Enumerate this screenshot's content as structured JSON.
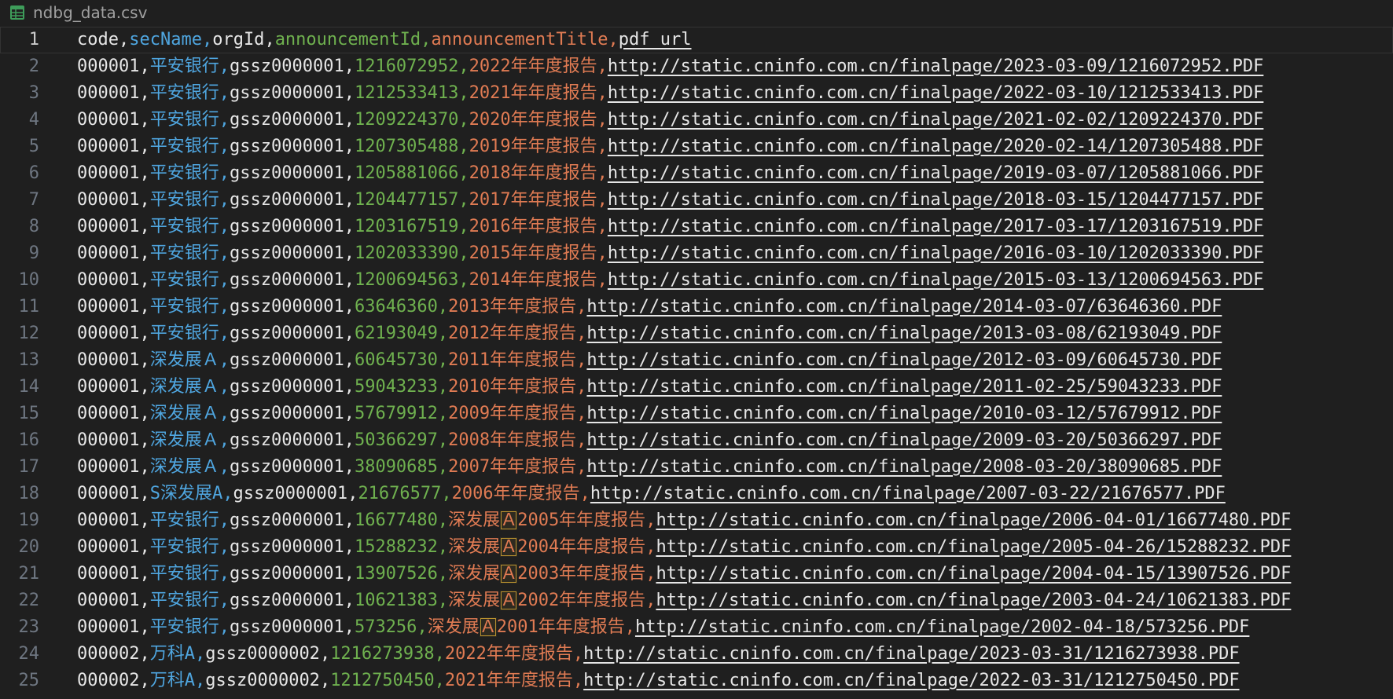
{
  "tab": {
    "title": "ndbg_data.csv",
    "icon": "table-icon",
    "icon_color": "#3e9d5a"
  },
  "editor": {
    "current_line": 1,
    "colors": {
      "code": "#e6e6e6",
      "secName": "#4fa6e0",
      "orgId": "#e6e6e6",
      "announcementId": "#6fb14f",
      "announcementTitle": "#e07b53",
      "pdf_url": "#e6e6e6",
      "line_number": "#6e7681",
      "background": "#1f1f1f"
    },
    "lines": [
      {
        "n": "1",
        "fields": [
          "code",
          "secName",
          "orgId",
          "announcementId",
          "announcementTitle",
          "pdf_url"
        ]
      },
      {
        "n": "2",
        "fields": [
          "000001",
          "平安银行",
          "gssz0000001",
          "1216072952",
          "2022年年度报告",
          "http://static.cninfo.com.cn/finalpage/2023-03-09/1216072952.PDF"
        ]
      },
      {
        "n": "3",
        "fields": [
          "000001",
          "平安银行",
          "gssz0000001",
          "1212533413",
          "2021年年度报告",
          "http://static.cninfo.com.cn/finalpage/2022-03-10/1212533413.PDF"
        ]
      },
      {
        "n": "4",
        "fields": [
          "000001",
          "平安银行",
          "gssz0000001",
          "1209224370",
          "2020年年度报告",
          "http://static.cninfo.com.cn/finalpage/2021-02-02/1209224370.PDF"
        ]
      },
      {
        "n": "5",
        "fields": [
          "000001",
          "平安银行",
          "gssz0000001",
          "1207305488",
          "2019年年度报告",
          "http://static.cninfo.com.cn/finalpage/2020-02-14/1207305488.PDF"
        ]
      },
      {
        "n": "6",
        "fields": [
          "000001",
          "平安银行",
          "gssz0000001",
          "1205881066",
          "2018年年度报告",
          "http://static.cninfo.com.cn/finalpage/2019-03-07/1205881066.PDF"
        ]
      },
      {
        "n": "7",
        "fields": [
          "000001",
          "平安银行",
          "gssz0000001",
          "1204477157",
          "2017年年度报告",
          "http://static.cninfo.com.cn/finalpage/2018-03-15/1204477157.PDF"
        ]
      },
      {
        "n": "8",
        "fields": [
          "000001",
          "平安银行",
          "gssz0000001",
          "1203167519",
          "2016年年度报告",
          "http://static.cninfo.com.cn/finalpage/2017-03-17/1203167519.PDF"
        ]
      },
      {
        "n": "9",
        "fields": [
          "000001",
          "平安银行",
          "gssz0000001",
          "1202033390",
          "2015年年度报告",
          "http://static.cninfo.com.cn/finalpage/2016-03-10/1202033390.PDF"
        ]
      },
      {
        "n": "10",
        "fields": [
          "000001",
          "平安银行",
          "gssz0000001",
          "1200694563",
          "2014年年度报告",
          "http://static.cninfo.com.cn/finalpage/2015-03-13/1200694563.PDF"
        ]
      },
      {
        "n": "11",
        "fields": [
          "000001",
          "平安银行",
          "gssz0000001",
          "63646360",
          "2013年年度报告",
          "http://static.cninfo.com.cn/finalpage/2014-03-07/63646360.PDF"
        ]
      },
      {
        "n": "12",
        "fields": [
          "000001",
          "平安银行",
          "gssz0000001",
          "62193049",
          "2012年年度报告",
          "http://static.cninfo.com.cn/finalpage/2013-03-08/62193049.PDF"
        ]
      },
      {
        "n": "13",
        "fields": [
          "000001",
          "深发展Ａ",
          "gssz0000001",
          "60645730",
          "2011年年度报告",
          "http://static.cninfo.com.cn/finalpage/2012-03-09/60645730.PDF"
        ]
      },
      {
        "n": "14",
        "fields": [
          "000001",
          "深发展Ａ",
          "gssz0000001",
          "59043233",
          "2010年年度报告",
          "http://static.cninfo.com.cn/finalpage/2011-02-25/59043233.PDF"
        ]
      },
      {
        "n": "15",
        "fields": [
          "000001",
          "深发展Ａ",
          "gssz0000001",
          "57679912",
          "2009年年度报告",
          "http://static.cninfo.com.cn/finalpage/2010-03-12/57679912.PDF"
        ]
      },
      {
        "n": "16",
        "fields": [
          "000001",
          "深发展Ａ",
          "gssz0000001",
          "50366297",
          "2008年年度报告",
          "http://static.cninfo.com.cn/finalpage/2009-03-20/50366297.PDF"
        ]
      },
      {
        "n": "17",
        "fields": [
          "000001",
          "深发展Ａ",
          "gssz0000001",
          "38090685",
          "2007年年度报告",
          "http://static.cninfo.com.cn/finalpage/2008-03-20/38090685.PDF"
        ]
      },
      {
        "n": "18",
        "fields": [
          "000001",
          "S深发展A",
          "gssz0000001",
          "21676577",
          "2006年年度报告",
          "http://static.cninfo.com.cn/finalpage/2007-03-22/21676577.PDF"
        ]
      },
      {
        "n": "19",
        "fields": [
          "000001",
          "平安银行",
          "gssz0000001",
          "16677480",
          "深发展Ａ2005年年度报告",
          "http://static.cninfo.com.cn/finalpage/2006-04-01/16677480.PDF"
        ],
        "ambiguous": "Ａ"
      },
      {
        "n": "20",
        "fields": [
          "000001",
          "平安银行",
          "gssz0000001",
          "15288232",
          "深发展Ａ2004年年度报告",
          "http://static.cninfo.com.cn/finalpage/2005-04-26/15288232.PDF"
        ],
        "ambiguous": "Ａ"
      },
      {
        "n": "21",
        "fields": [
          "000001",
          "平安银行",
          "gssz0000001",
          "13907526",
          "深发展Ａ2003年年度报告",
          "http://static.cninfo.com.cn/finalpage/2004-04-15/13907526.PDF"
        ],
        "ambiguous": "Ａ"
      },
      {
        "n": "22",
        "fields": [
          "000001",
          "平安银行",
          "gssz0000001",
          "10621383",
          "深发展Ａ2002年年度报告",
          "http://static.cninfo.com.cn/finalpage/2003-04-24/10621383.PDF"
        ],
        "ambiguous": "Ａ"
      },
      {
        "n": "23",
        "fields": [
          "000001",
          "平安银行",
          "gssz0000001",
          "573256",
          "深发展Ａ2001年年度报告",
          "http://static.cninfo.com.cn/finalpage/2002-04-18/573256.PDF"
        ],
        "ambiguous": "Ａ"
      },
      {
        "n": "24",
        "fields": [
          "000002",
          "万科A",
          "gssz0000002",
          "1216273938",
          "2022年年度报告",
          "http://static.cninfo.com.cn/finalpage/2023-03-31/1216273938.PDF"
        ]
      },
      {
        "n": "25",
        "fields": [
          "000002",
          "万科A",
          "gssz0000002",
          "1212750450",
          "2021年年度报告",
          "http://static.cninfo.com.cn/finalpage/2022-03-31/1212750450.PDF"
        ]
      }
    ]
  }
}
